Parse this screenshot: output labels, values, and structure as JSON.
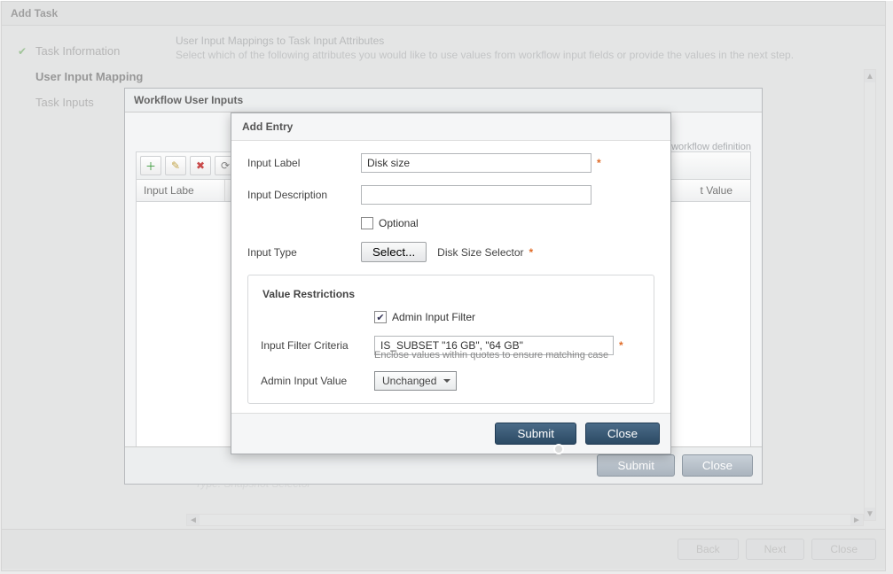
{
  "wizard": {
    "title": "Add Task",
    "steps": {
      "step1": "Task Information",
      "step2": "User Input Mapping",
      "step3": "Task Inputs"
    },
    "hint_title": "User Input Mappings to Task Input Attributes",
    "hint_sub": "Select which of the following attributes you would like to use values from workflow input fields or provide the values in the next step.",
    "snap_type": "Type: Snapshot Selector",
    "buttons": {
      "back": "Back",
      "next": "Next",
      "close": "Close"
    }
  },
  "mid": {
    "title": "Workflow User Inputs",
    "info": "e workflow definition",
    "cols": {
      "c1": "Input Labe",
      "c3": "t Value"
    },
    "buttons": {
      "submit": "Submit",
      "close": "Close"
    }
  },
  "entry": {
    "title": "Add Entry",
    "labels": {
      "input_label": "Input Label",
      "input_desc": "Input Description",
      "optional": "Optional",
      "input_type": "Input Type",
      "value_restrictions": "Value Restrictions",
      "admin_filter": "Admin Input Filter",
      "filter_criteria": "Input Filter Criteria",
      "criteria_hint": "Enclose values within quotes to ensure matching case",
      "admin_value": "Admin Input Value"
    },
    "values": {
      "input_label": "Disk size",
      "input_desc": "",
      "select_btn": "Select...",
      "type_text": "Disk Size Selector",
      "filter_criteria": "IS_SUBSET \"16 GB\", \"64 GB\"",
      "admin_value": "Unchanged"
    },
    "buttons": {
      "submit": "Submit",
      "close": "Close"
    }
  }
}
